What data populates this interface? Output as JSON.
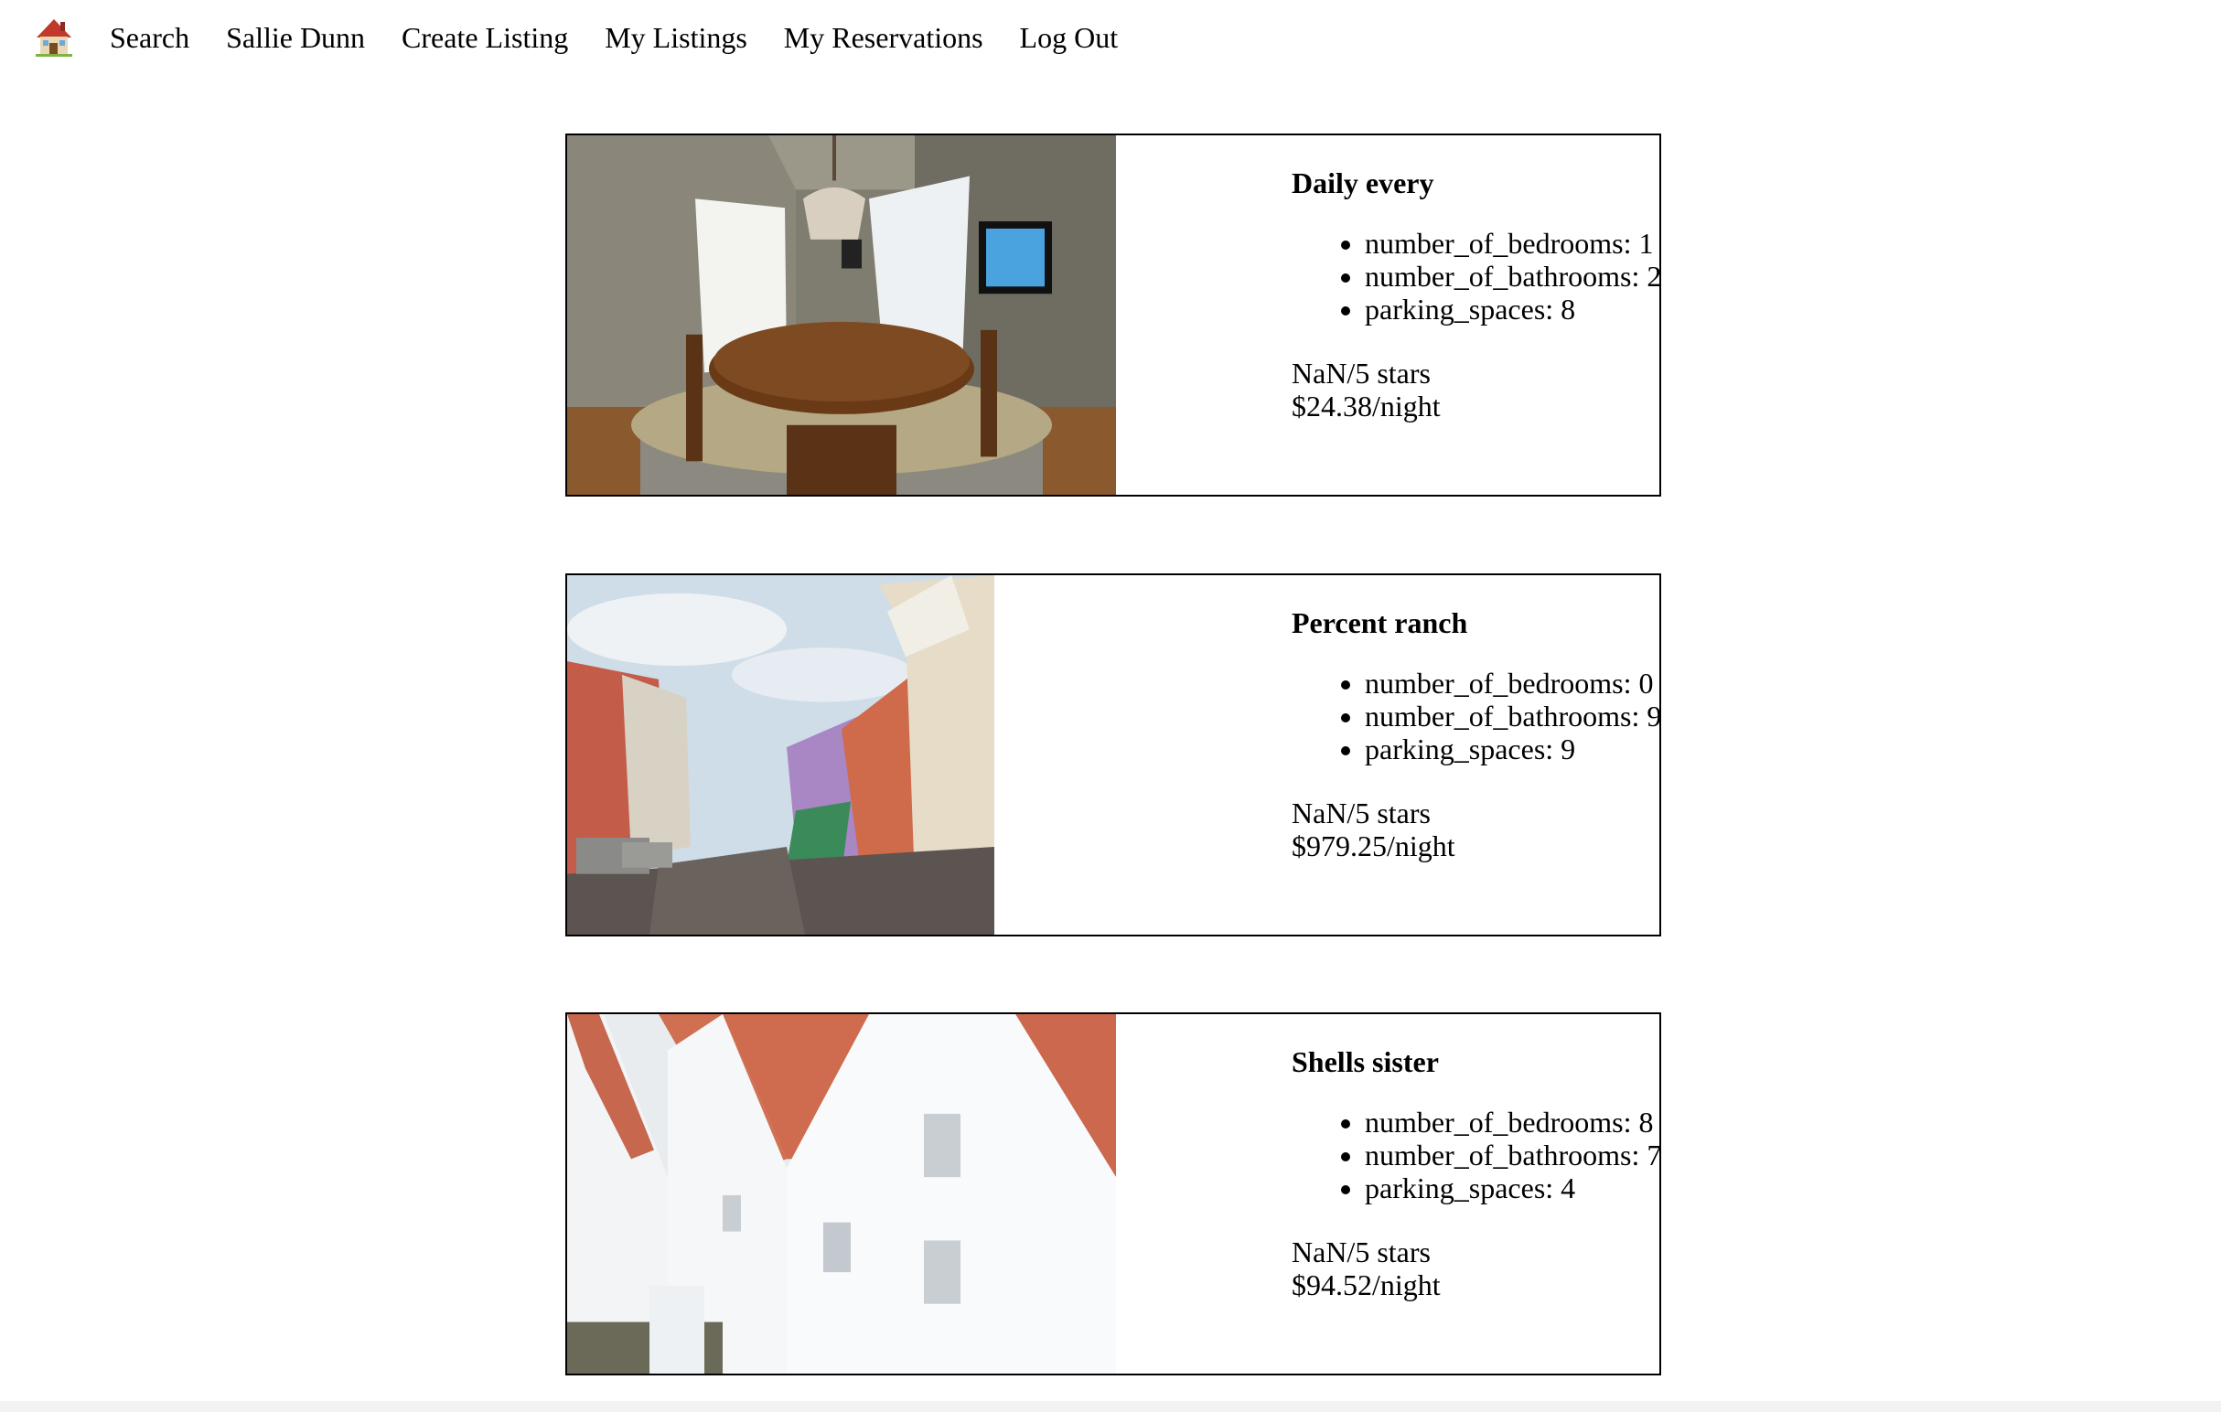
{
  "nav": {
    "home_icon": "house-emoji-icon",
    "links": [
      "Search",
      "Sallie Dunn",
      "Create Listing",
      "My Listings",
      "My Reservations",
      "Log Out"
    ]
  },
  "listings": [
    {
      "image": "dining-room-photo",
      "title": "Daily every",
      "features": [
        "number_of_bedrooms: 1",
        "number_of_bathrooms: 2",
        "parking_spaces: 8"
      ],
      "rating": "NaN/5 stars",
      "price": "$24.38/night"
    },
    {
      "image": "colorful-street-photo",
      "title": "Percent ranch",
      "features": [
        "number_of_bedrooms: 0",
        "number_of_bathrooms: 9",
        "parking_spaces: 9"
      ],
      "rating": "NaN/5 stars",
      "price": "$979.25/night"
    },
    {
      "image": "white-houses-photo",
      "title": "Shells sister",
      "features": [
        "number_of_bedrooms: 8",
        "number_of_bathrooms: 7",
        "parking_spaces: 4"
      ],
      "rating": "NaN/5 stars",
      "price": "$94.52/night"
    }
  ]
}
